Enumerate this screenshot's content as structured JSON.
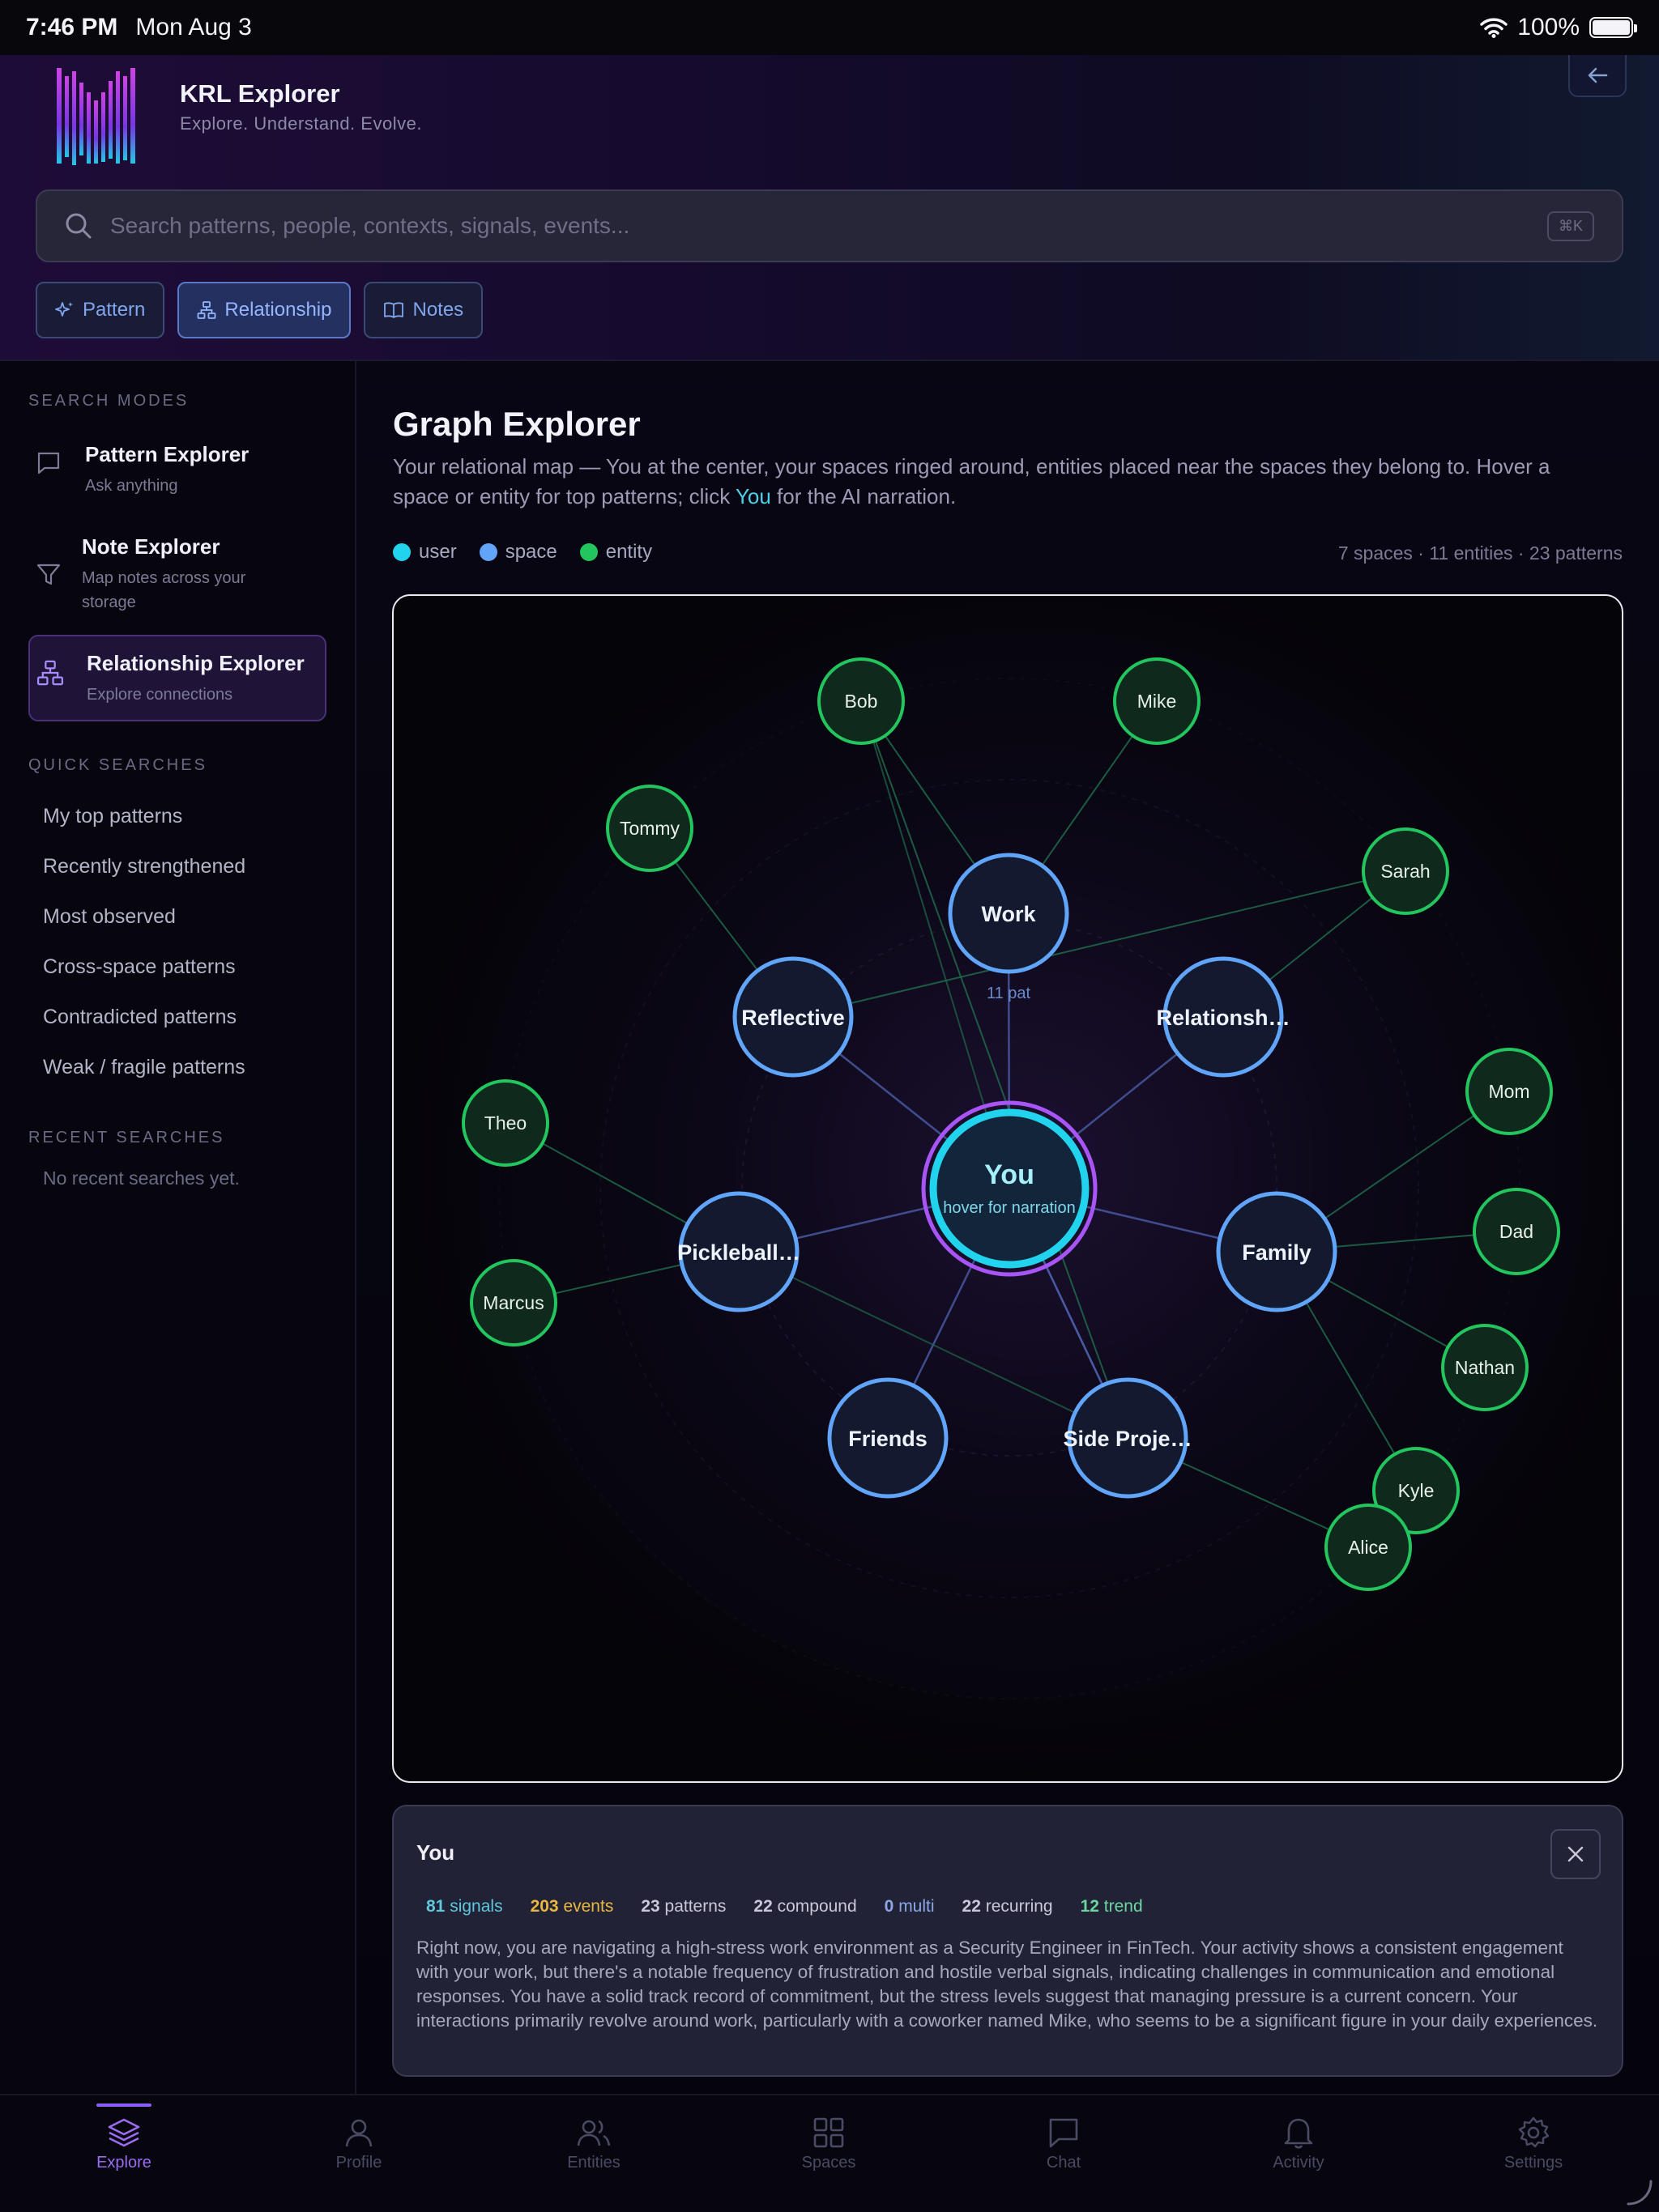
{
  "status": {
    "time": "7:46 PM",
    "date": "Mon Aug 3",
    "battery": "100%"
  },
  "app": {
    "title": "KRL Explorer",
    "subtitle": "Explore. Understand. Evolve."
  },
  "search": {
    "placeholder": "Search patterns, people, contexts, signals, events...",
    "shortcut": "⌘K"
  },
  "chips": [
    {
      "label": "Pattern"
    },
    {
      "label": "Relationship"
    },
    {
      "label": "Notes"
    }
  ],
  "sidebar": {
    "modes_label": "SEARCH MODES",
    "modes": [
      {
        "title": "Pattern Explorer",
        "sub": "Ask anything"
      },
      {
        "title": "Note Explorer",
        "sub": "Map notes across your storage"
      },
      {
        "title": "Relationship Explorer",
        "sub": "Explore connections"
      }
    ],
    "quick_label": "QUICK SEARCHES",
    "quick": [
      "My top patterns",
      "Recently strengthened",
      "Most observed",
      "Cross-space patterns",
      "Contradicted patterns",
      "Weak / fragile patterns"
    ],
    "recent_label": "RECENT SEARCHES",
    "recent_empty": "No recent searches yet."
  },
  "main": {
    "title": "Graph Explorer",
    "desc_pre": "Your relational map — You at the center, your spaces ringed around, entities placed near the spaces they belong to. Hover a space or entity for top patterns; click ",
    "desc_link": "You",
    "desc_post": " for the AI narration.",
    "legend": [
      {
        "label": "user",
        "color": "#22d3ee"
      },
      {
        "label": "space",
        "color": "#60a5fa"
      },
      {
        "label": "entity",
        "color": "#22c55e"
      }
    ],
    "counts": "7 spaces · 11 entities · 23 patterns"
  },
  "graph": {
    "center": {
      "label": "You",
      "sub": "hover for narration"
    },
    "spaces": [
      {
        "label": "Work",
        "sub": "11 pat"
      },
      {
        "label": "Relationsh…"
      },
      {
        "label": "Family"
      },
      {
        "label": "Side Proje…"
      },
      {
        "label": "Friends"
      },
      {
        "label": "Pickleball…"
      },
      {
        "label": "Reflective"
      }
    ],
    "entities": [
      "Bob",
      "Mike",
      "Tommy",
      "Sarah",
      "Theo",
      "Mom",
      "Dad",
      "Marcus",
      "Nathan",
      "Kyle",
      "Alice"
    ]
  },
  "detail": {
    "title": "You",
    "stats": [
      {
        "value": "81",
        "label": "signals",
        "color": "#5ec8dc"
      },
      {
        "value": "203",
        "label": "events",
        "color": "#e8b840"
      },
      {
        "value": "23",
        "label": "patterns",
        "color": "#c8c8d8"
      },
      {
        "value": "22",
        "label": "compound",
        "color": "#c8c8d8"
      },
      {
        "value": "0",
        "label": "multi",
        "color": "#8aa8e8"
      },
      {
        "value": "22",
        "label": "recurring",
        "color": "#c8c8d8"
      },
      {
        "value": "12",
        "label": "trend",
        "color": "#6cd6a0"
      }
    ],
    "narration": "Right now, you are navigating a high-stress work environment as a Security Engineer in FinTech. Your activity shows a consistent engagement with your work, but there's a notable frequency of frustration and hostile verbal signals, indicating challenges in communication and emotional responses. You have a solid track record of commitment, but the stress levels suggest that managing pressure is a current concern. Your interactions primarily revolve around work, particularly with a coworker named Mike, who seems to be a significant figure in your daily experiences."
  },
  "tabs": [
    {
      "label": "Explore"
    },
    {
      "label": "Profile"
    },
    {
      "label": "Entities"
    },
    {
      "label": "Spaces"
    },
    {
      "label": "Chat"
    },
    {
      "label": "Activity"
    },
    {
      "label": "Settings"
    }
  ]
}
